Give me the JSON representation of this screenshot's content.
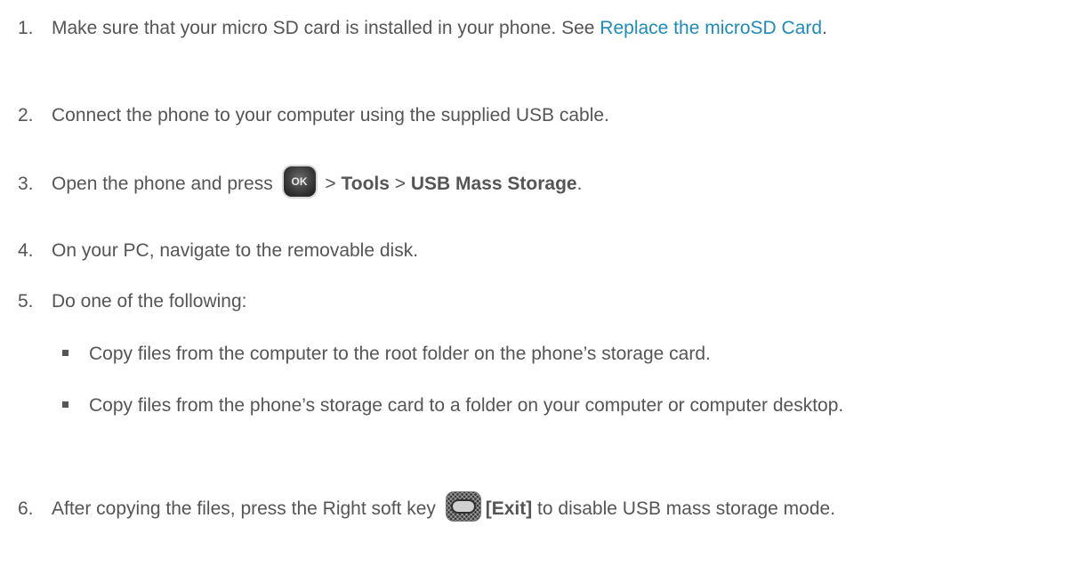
{
  "steps": [
    {
      "num": "1.",
      "before": "Make sure that your micro SD card is installed in your phone. See ",
      "link": "Replace the microSD Card",
      "after": "."
    },
    {
      "num": "2.",
      "text": "Connect the phone to your computer using the supplied USB cable."
    },
    {
      "num": "3.",
      "before": "Open the phone and press ",
      "key_label": "OK",
      "sep1": " > ",
      "b1": "Tools",
      "sep2": " > ",
      "b2": "USB Mass Storage",
      "after": "."
    },
    {
      "num": "4.",
      "text": "On your PC, navigate to the removable disk."
    },
    {
      "num": "5.",
      "text": "Do one of the following:",
      "bullets": [
        "Copy files from the computer to the root folder on the phone’s storage card.",
        "Copy files from the phone’s storage card to a folder on your computer or computer desktop."
      ]
    },
    {
      "num": "6.",
      "before": "After copying the files, press the Right soft key ",
      "bold": "[Exit]",
      "after": " to disable USB mass storage mode."
    }
  ],
  "icons": {
    "ok_key": "ok-key-icon",
    "soft_key": "right-soft-key-icon"
  },
  "colors": {
    "text": "#555555",
    "link": "#1f8bb6"
  }
}
